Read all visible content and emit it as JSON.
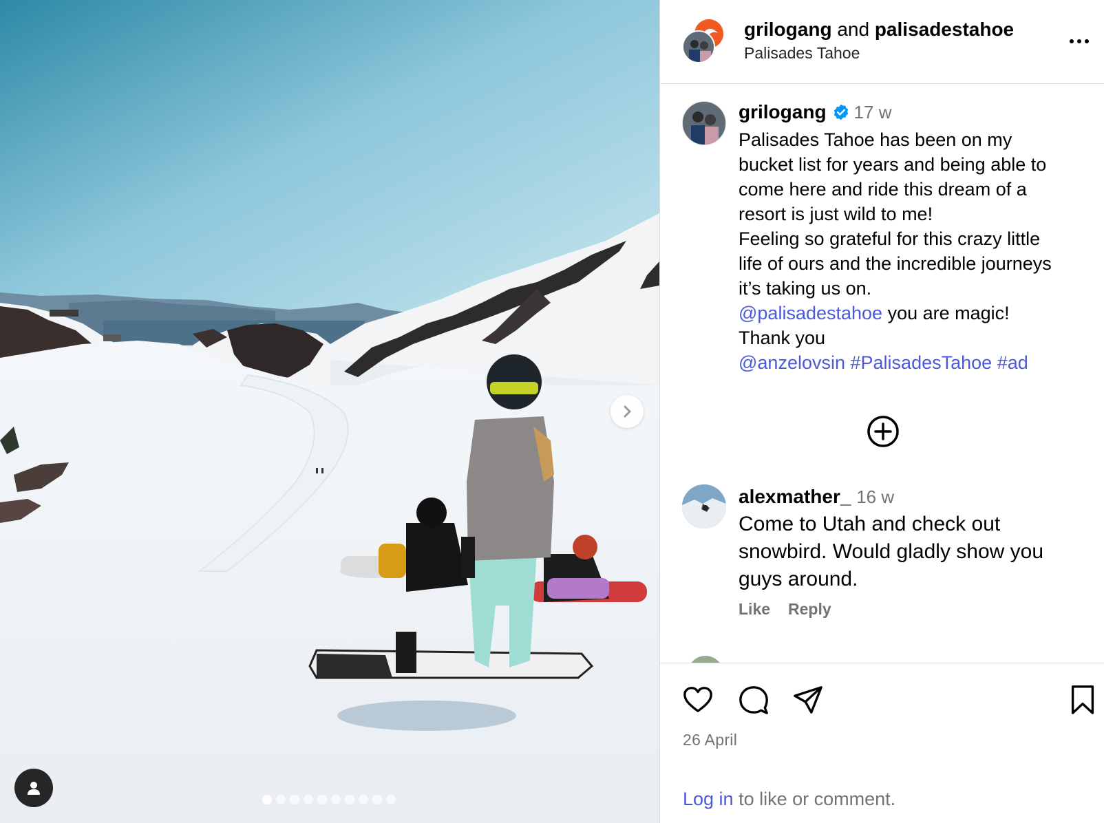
{
  "header": {
    "author": "grilogang",
    "joiner": "and",
    "collaborator": "palisadestahoe",
    "location": "Palisades Tahoe"
  },
  "caption": {
    "username": "grilogang",
    "verified": true,
    "time_ago": "17 w",
    "lines": [
      "Palisades Tahoe has been on my",
      "bucket list for years and being able to",
      "come here and ride this dream of a",
      "resort is just wild to me!",
      "Feeling so grateful for this crazy little",
      "life of ours and the incredible journeys",
      "it’s taking us on."
    ],
    "mention1": "@palisadestahoe",
    "mention1_suffix": " you are magic!",
    "thanks": "Thank you",
    "mention2": "@anzelovsin",
    "hashtag1": "#PalisadesTahoe",
    "hashtag2": "#ad"
  },
  "comment": {
    "username": "alexmather_",
    "time_ago": "16 w",
    "lines": [
      "Come to Utah and check out",
      "snowbird. Would gladly show you",
      "guys around."
    ],
    "like_label": "Like",
    "reply_label": "Reply"
  },
  "footer": {
    "date": "26 April",
    "login_link": "Log in",
    "login_suffix": " to like or comment."
  },
  "carousel": {
    "total_slides": 10,
    "active_index": 0
  },
  "icons": {
    "like": "heart-icon",
    "comment": "speech-bubble-icon",
    "share": "paper-plane-icon",
    "save": "bookmark-icon",
    "more": "ellipsis-icon",
    "next": "chevron-right-icon",
    "tags": "user-icon",
    "load_more": "plus-circle-icon",
    "verified": "verified-badge-icon"
  },
  "colors": {
    "link": "#4a5ad8",
    "verified": "#0095f6",
    "muted": "#737373",
    "border": "#dbdbdb"
  }
}
